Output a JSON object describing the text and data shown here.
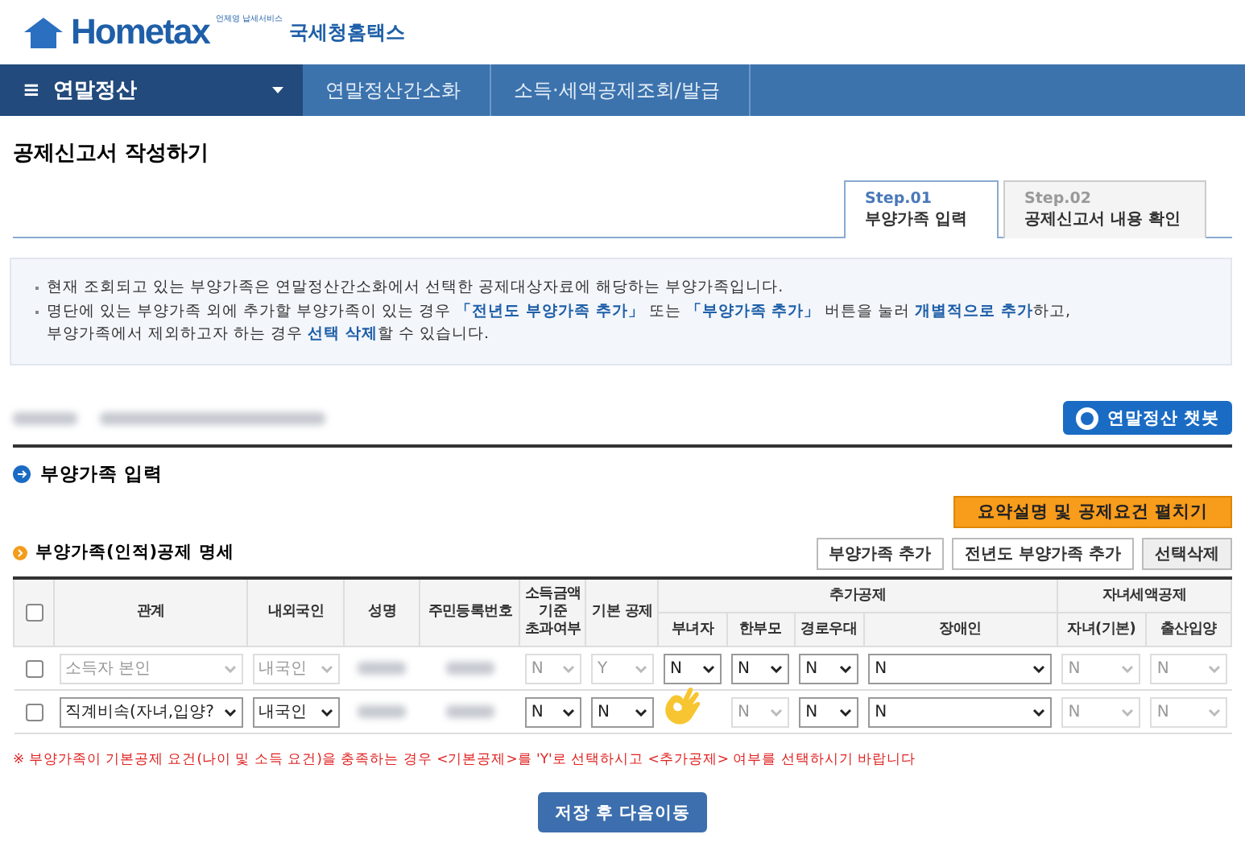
{
  "logo": {
    "tagline": "언제영 납세서비스",
    "brand": "Hometax",
    "org": "국세청홈택스"
  },
  "nav": {
    "menu_icon": "≡",
    "current": "연말정산",
    "crumbs": [
      "연말정산간소화",
      "소득·세액공제조회/발급"
    ]
  },
  "page_title": "공제신고서 작성하기",
  "steps": [
    {
      "step": "Step.01",
      "label": "부양가족 입력",
      "selected": true
    },
    {
      "step": "Step.02",
      "label": "공제신고서 내용 확인",
      "selected": false
    }
  ],
  "notices": [
    "현재 조회되고 있는 부양가족은 연말정산간소화에서 선택한 공제대상자료에 해당하는 부양가족입니다.",
    "명단에 있는 부양가족 외에 추가할 부양가족이 있는 경우 **「전년도 부양가족 추가」** 또는 **「부양가족 추가」** 버튼을 눌러 **개별적으로 추가**하고, 부양가족에서 제외하고자 하는 경우 **선택 삭제**할 수 있습니다."
  ],
  "chatbot_button": "연말정산 챗봇",
  "section_title": "부양가족 입력",
  "expand_button": "요약설명 및 공제요건 펼치기",
  "table_title": "부양가족(인적)공제 명세",
  "select_all_checked": false,
  "table_buttons": [
    "부양가족 추가",
    "전년도 부양가족 추가",
    "선택삭제"
  ],
  "columns": [
    {
      "label": "관계"
    },
    {
      "label": "내외국인"
    },
    {
      "label": "성명"
    },
    {
      "label": "주민등록번호"
    },
    {
      "label": "소득금액 기준 초과여부"
    },
    {
      "label": "기본 공제"
    },
    {
      "label": "추가공제",
      "children": [
        "부녀자",
        "한부모",
        "경로우대",
        "장애인"
      ]
    },
    {
      "label": "자녀세액공제",
      "children": [
        "자녀(기본)",
        "출산입양"
      ]
    }
  ],
  "rows": [
    {
      "checked": false,
      "cells": [
        {
          "kind": "select",
          "value": "소득자 본인",
          "disabled": true
        },
        {
          "kind": "select",
          "value": "내국인",
          "disabled": true
        },
        {
          "kind": "redacted"
        },
        {
          "kind": "redacted"
        },
        {
          "kind": "select",
          "value": "N",
          "disabled": true
        },
        {
          "kind": "select",
          "value": "Y",
          "disabled": true
        },
        {
          "kind": "select",
          "value": "N",
          "disabled": false
        },
        {
          "kind": "select",
          "value": "N",
          "disabled": false
        },
        {
          "kind": "select",
          "value": "N",
          "disabled": false
        },
        {
          "kind": "select",
          "value": "N",
          "disabled": false
        },
        {
          "kind": "select",
          "value": "N",
          "disabled": true
        },
        {
          "kind": "select",
          "value": "N",
          "disabled": true
        }
      ]
    },
    {
      "checked": false,
      "cells": [
        {
          "kind": "select",
          "value": "직계비속(자녀,입양?",
          "disabled": false
        },
        {
          "kind": "select",
          "value": "내국인",
          "disabled": false
        },
        {
          "kind": "redacted"
        },
        {
          "kind": "redacted"
        },
        {
          "kind": "select",
          "value": "N",
          "disabled": false
        },
        {
          "kind": "select",
          "value": "N",
          "disabled": false
        },
        {
          "kind": "hidden"
        },
        {
          "kind": "select",
          "value": "N",
          "disabled": true
        },
        {
          "kind": "select",
          "value": "N",
          "disabled": false
        },
        {
          "kind": "select",
          "value": "N",
          "disabled": false
        },
        {
          "kind": "select",
          "value": "N",
          "disabled": true
        },
        {
          "kind": "select",
          "value": "N",
          "disabled": true
        }
      ]
    }
  ],
  "warning": "※ 부양가족이 기본공제 요건(나이 및 소득 요건)을 충족하는 경우 <기본공제>를 'Y'로 선택하시고 <추가공제> 여부를 선택하시기 바랍니다",
  "save_button": "저장 후 다음이동"
}
